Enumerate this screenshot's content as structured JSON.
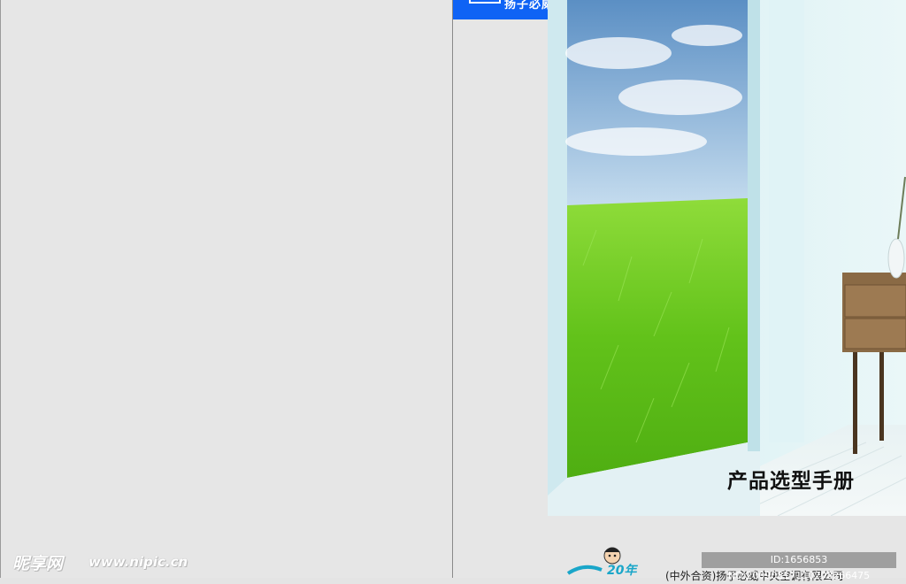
{
  "cover": {
    "title": "产品选型手册",
    "company": "(中外合资)扬子必威中央空调有限公司",
    "tab_text": "扬子必威",
    "mascot_years": "20年"
  },
  "watermark": {
    "site_name": "昵享网",
    "site_url": "www.nipic.cn",
    "image_id": "ID:1656853 NO:20090817110202266475"
  },
  "colors": {
    "accent_blue": "#0f63f5",
    "grass_green": "#6cc41c",
    "sky_blue": "#a8cbe4"
  }
}
